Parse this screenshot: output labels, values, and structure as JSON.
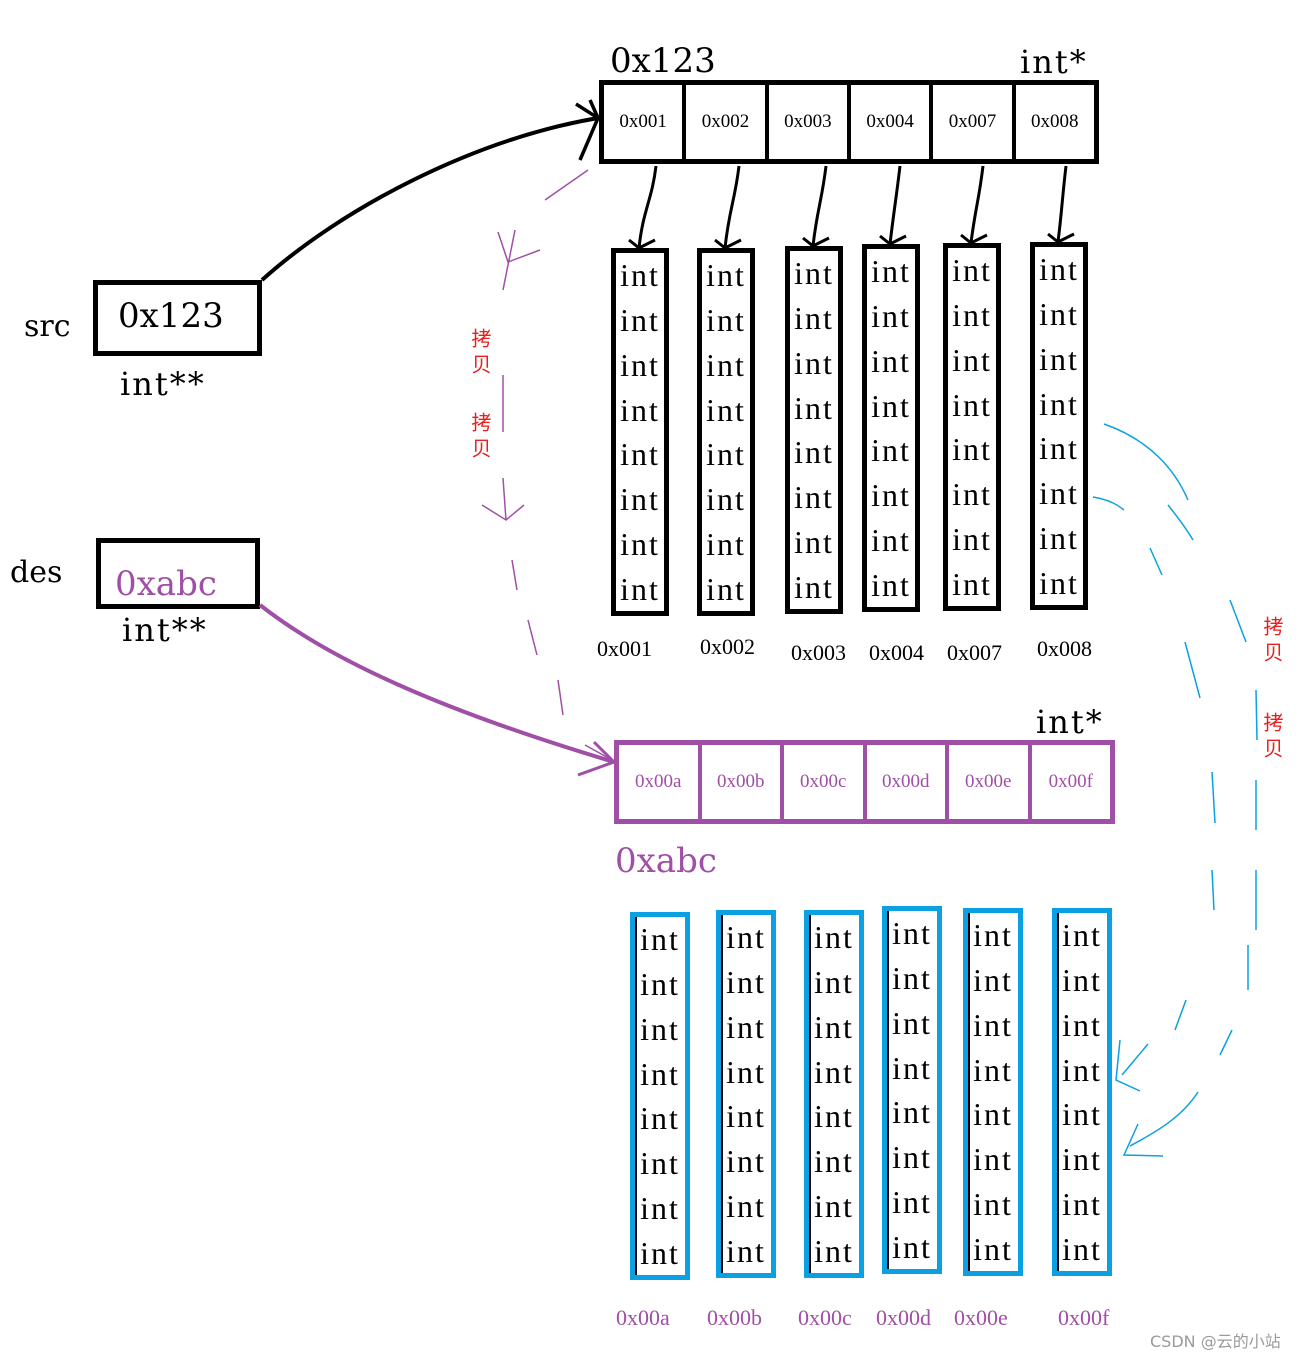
{
  "src": {
    "name": "src",
    "value": "0x123",
    "type": "int**"
  },
  "des": {
    "name": "des",
    "value": "0xabc",
    "type": "int**"
  },
  "src_pointer_array": {
    "address": "0x123",
    "type": "int*",
    "cells": [
      "0x001",
      "0x002",
      "0x003",
      "0x004",
      "0x007",
      "0x008"
    ]
  },
  "src_int_columns": {
    "cell_label": "int",
    "rows_per_column": 8,
    "addresses": [
      "0x001",
      "0x002",
      "0x003",
      "0x004",
      "0x007",
      "0x008"
    ]
  },
  "des_pointer_array": {
    "address": "0xabc",
    "type": "int*",
    "cells": [
      "0x00a",
      "0x00b",
      "0x00c",
      "0x00d",
      "0x00e",
      "0x00f"
    ]
  },
  "des_int_columns": {
    "cell_label": "int",
    "rows_per_column": 8,
    "addresses": [
      "0x00a",
      "0x00b",
      "0x00c",
      "0x00d",
      "0x00e",
      "0x00f"
    ]
  },
  "copy_annotations": {
    "left": [
      "拷贝",
      "拷贝"
    ],
    "right": [
      "拷贝",
      "拷贝"
    ]
  },
  "colors": {
    "src": "#000000",
    "des": "#a04fa6",
    "des_columns": "#0ba0e2",
    "copy_text": "#e8201e"
  },
  "watermark": "CSDN @云的小站"
}
